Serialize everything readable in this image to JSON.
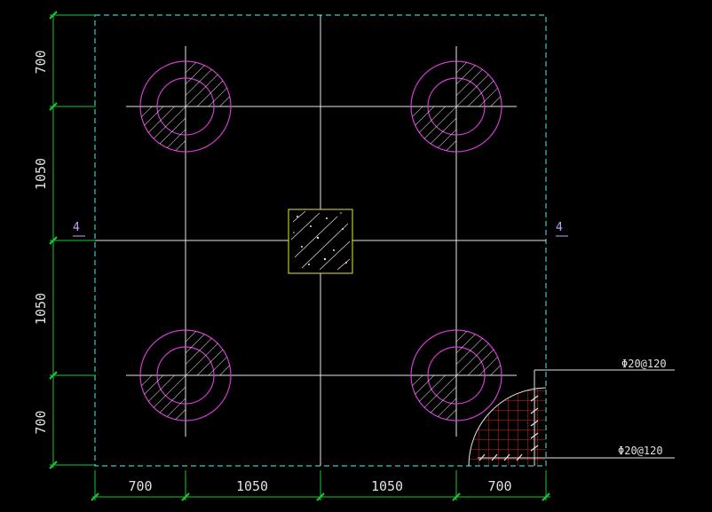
{
  "drawing": {
    "dims_bottom": [
      "700",
      "1050",
      "1050",
      "700"
    ],
    "dims_left": [
      "700",
      "1050",
      "1050",
      "700"
    ],
    "section_mark_left": "4",
    "section_mark_right": "4",
    "rebar_top": "Φ20@120",
    "rebar_bottom": "Φ20@120"
  },
  "colors": {
    "background": "#000000",
    "dimension": "#19c832",
    "outline": "#3cc8c8",
    "pile": "#d23cd2",
    "axis": "#e6e6e6",
    "column": "#e6e632",
    "rebar": "#e02020"
  }
}
